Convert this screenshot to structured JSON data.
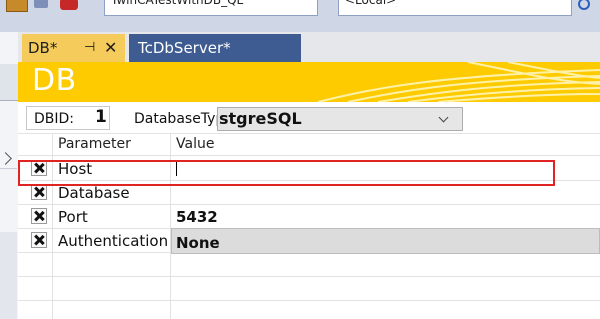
{
  "toolbar": {
    "combo1_text": "TwinCATestWithDB_QL",
    "combo2_text": "<Local>"
  },
  "tabs": [
    {
      "label": "DB*",
      "pin": "⊣",
      "close": "✕"
    },
    {
      "label": "TcDbServer*"
    }
  ],
  "banner": {
    "title": "DB"
  },
  "db": {
    "dbid_label": "DBID:",
    "dbid_value": "1",
    "dbtype_label": "DatabaseType",
    "dbtype_value": "stgreSQL"
  },
  "grid": {
    "headers": [
      "Parameter",
      "Value"
    ],
    "rows": [
      {
        "name": "Host",
        "value": ""
      },
      {
        "name": "Database",
        "value": ""
      },
      {
        "name": "Port",
        "value": "5432"
      },
      {
        "name": "Authentication",
        "value": "None"
      }
    ]
  },
  "colors": {
    "banner": "#fecb01",
    "active_tab": "#f5cc5c",
    "inactive_tab": "#3e5b92",
    "highlight": "#e02424"
  }
}
